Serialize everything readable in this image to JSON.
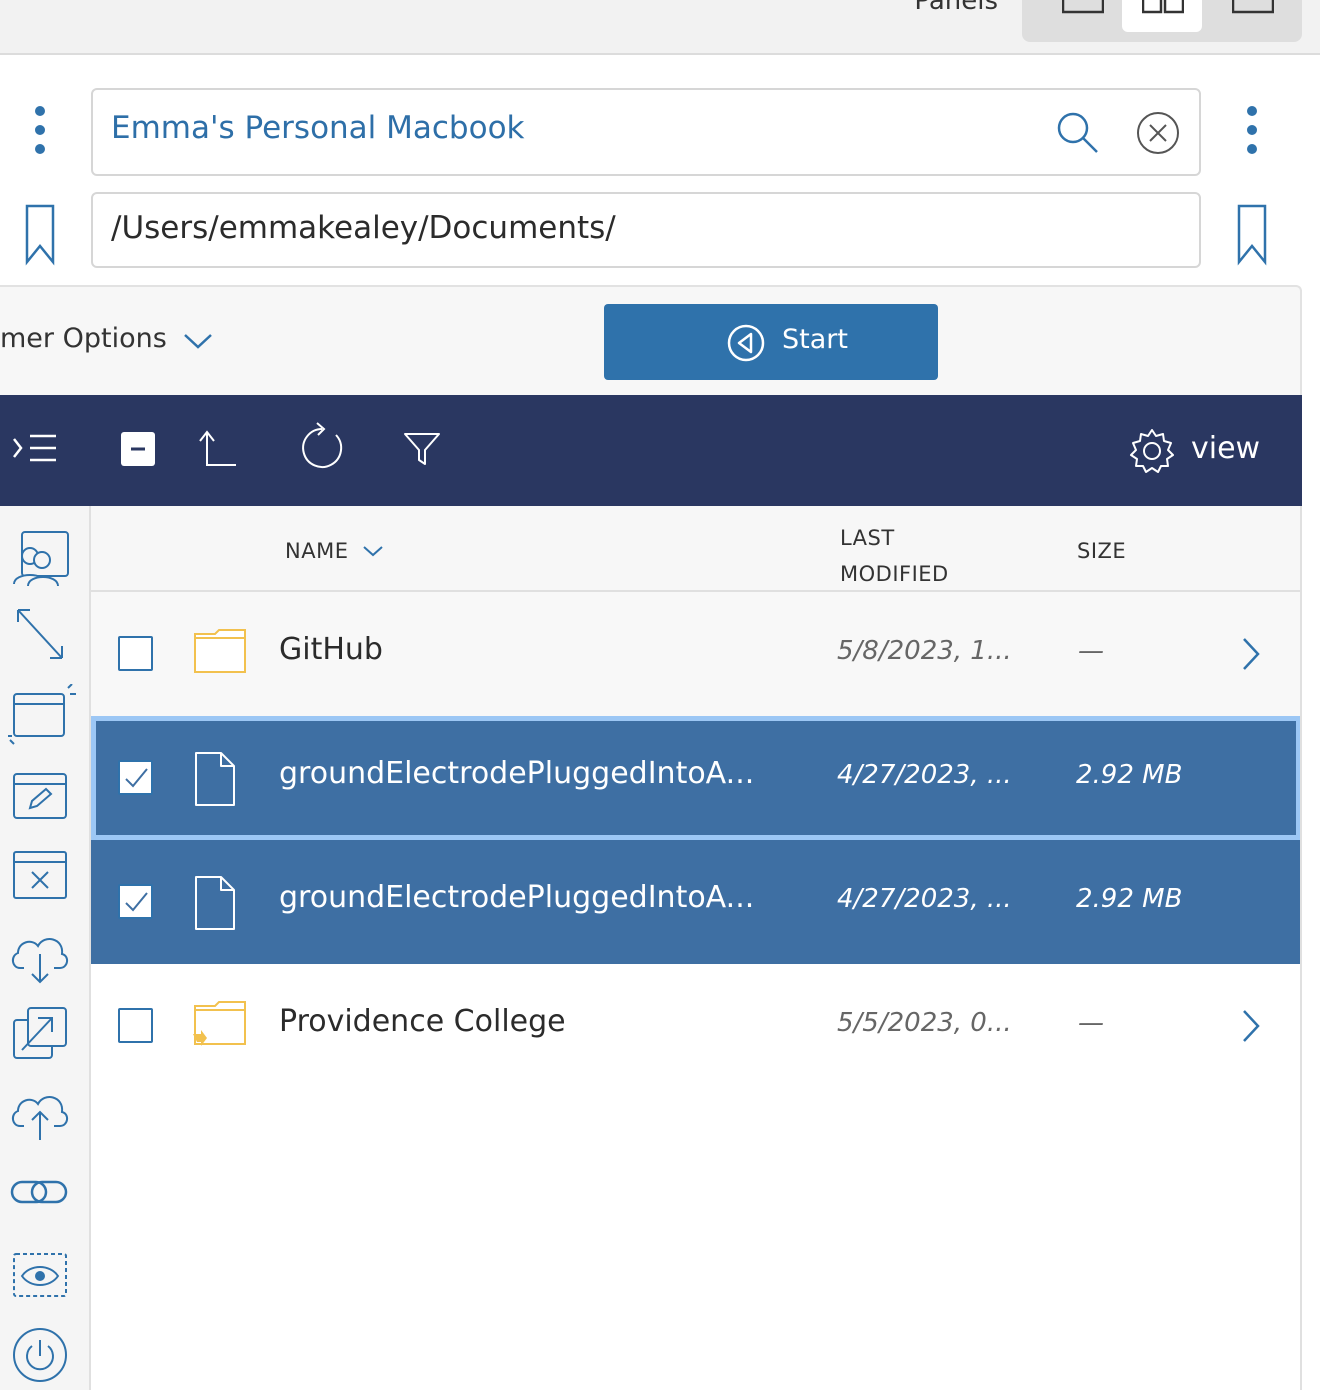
{
  "topbar": {
    "panels_label": "Panels"
  },
  "connection": {
    "host_value": "Emma's Personal Macbook",
    "path_value": "/Users/emmakealey/Documents/"
  },
  "options": {
    "label": "mer Options",
    "start_label": "Start"
  },
  "toolbar": {
    "view_label": "view"
  },
  "table": {
    "headers": {
      "name": "NAME",
      "modified_line1": "LAST",
      "modified_line2": "MODIFIED",
      "size": "SIZE"
    },
    "rows": [
      {
        "name": "GitHub",
        "modified": "5/8/2023, 1...",
        "size": "—",
        "type": "folder",
        "checked": false
      },
      {
        "name": "groundElectrodePluggedIntoA...",
        "modified": "4/27/2023, ...",
        "size": "2.92 MB",
        "type": "file",
        "checked": true
      },
      {
        "name": "groundElectrodePluggedIntoA...",
        "modified": "4/27/2023, ...",
        "size": "2.92 MB",
        "type": "file",
        "checked": true
      },
      {
        "name": "Providence College",
        "modified": "5/5/2023, 0...",
        "size": "—",
        "type": "folder-shortcut",
        "checked": false
      }
    ]
  },
  "colors": {
    "accent": "#2f72ab",
    "toolbar_bg": "#2a3761",
    "selected_row": "#3e6fa3",
    "focus_border": "#9cc7f5",
    "folder": "#f2c14e"
  }
}
